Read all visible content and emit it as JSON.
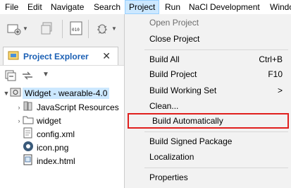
{
  "menubar": {
    "items": [
      "File",
      "Edit",
      "Navigate",
      "Search",
      "Project",
      "Run",
      "NaCl Development",
      "Windo"
    ]
  },
  "explorer": {
    "tab_title": "Project Explorer",
    "tab_close": "✕",
    "tree": [
      {
        "label": "Widget - wearable-4.0",
        "icon": "project-icon",
        "expanded": true
      },
      {
        "label": "JavaScript Resources",
        "icon": "library-icon"
      },
      {
        "label": "widget",
        "icon": "folder-icon"
      },
      {
        "label": "config.xml",
        "icon": "xml-file-icon"
      },
      {
        "label": "icon.png",
        "icon": "image-file-icon"
      },
      {
        "label": "index.html",
        "icon": "html-file-icon"
      }
    ]
  },
  "project_menu": {
    "items": [
      {
        "label": "Open Project",
        "enabled": false
      },
      {
        "label": "Close Project",
        "enabled": true
      },
      {
        "label": "Build All",
        "shortcut": "Ctrl+B",
        "enabled": true
      },
      {
        "label": "Build Project",
        "shortcut": "F10",
        "enabled": true
      },
      {
        "label": "Build Working Set",
        "submenu": ">",
        "enabled": true
      },
      {
        "label": "Clean...",
        "enabled": true
      },
      {
        "label": "Build Automatically",
        "enabled": true,
        "highlighted": true
      },
      {
        "label": "Build Signed Package",
        "enabled": true
      },
      {
        "label": "Localization",
        "enabled": true
      },
      {
        "label": "Properties",
        "enabled": true
      }
    ]
  },
  "colors": {
    "highlight_box": "#e0201e",
    "tab_title": "#1a5fb4",
    "active_menu_bg": "#cce8ff"
  }
}
